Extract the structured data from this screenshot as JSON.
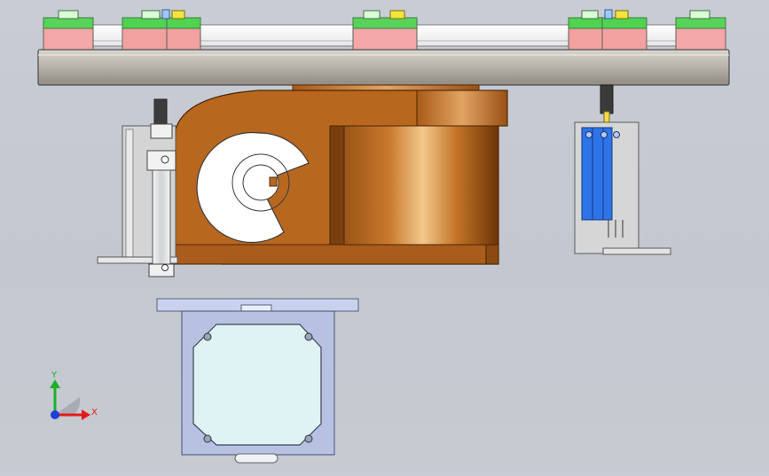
{
  "viewport": {
    "triad": {
      "x_label": "X",
      "y_label": "Y",
      "x_color": "#e31b1b",
      "y_color": "#1fae2a",
      "z_color": "#1f3fd6"
    },
    "colors": {
      "background": "#c6cad1",
      "bronze": "#b8671f",
      "bronze_dark": "#7a3f0f",
      "plate_metal": "#b7b4ad",
      "pink_block": "#f4a7a7",
      "green_cap": "#49d14a",
      "yellow_cap": "#f2e23c",
      "sensor_blue": "#2f73e8",
      "motor_face": "#dff2f4",
      "motor_frame": "#c7d1ea"
    }
  }
}
